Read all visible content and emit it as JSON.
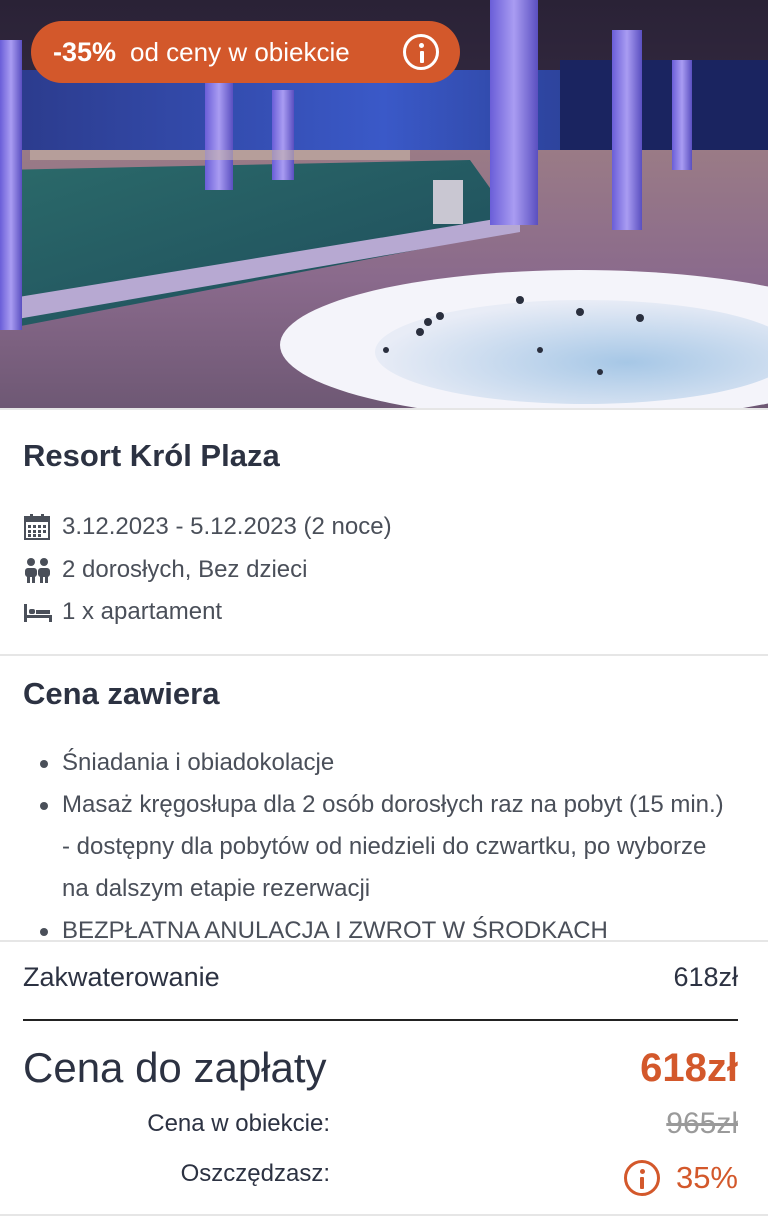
{
  "hero": {
    "image_name": "resort-pool-photo",
    "discount_percent": "-35%",
    "discount_text": "od ceny w obiekcie",
    "info_icon": "info-icon"
  },
  "hotel": {
    "name": "Resort Król Plaza",
    "dates": "3.12.2023 - 5.12.2023 (2 noce)",
    "guests": "2 dorosłych,  Bez dzieci",
    "rooms": "1 x apartament",
    "icons": {
      "dates": "calendar-icon",
      "guests": "people-icon",
      "rooms": "bed-icon"
    }
  },
  "includes": {
    "title": "Cena zawiera",
    "items": [
      "Śniadania i obiadokolacje",
      "Masaż kręgosłupa dla 2 osób dorosłych raz na pobyt (15 min.) - dostępny dla pobytów od niedzieli do czwartku, po wyborze na dalszym etapie rezerwacji",
      "BEZPŁATNA ANULACJA I ZWROT W ŚRODKACH"
    ]
  },
  "pricing": {
    "accommodation_label": "Zakwaterowanie",
    "accommodation_value": "618zł",
    "total_label": "Cena do zapłaty",
    "total_value": "618zł",
    "hotel_price_label": "Cena w obiekcie:",
    "hotel_price_value": "965zł",
    "savings_label": "Oszczędzasz:",
    "savings_value": "35%"
  },
  "colors": {
    "accent": "#d3582b",
    "text": "#2c3242",
    "muted": "#4a4f59"
  }
}
